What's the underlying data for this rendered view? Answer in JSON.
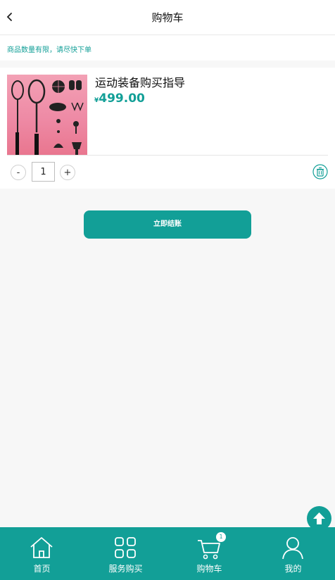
{
  "header": {
    "title": "购物车",
    "back_icon": "chevron-left-icon"
  },
  "notice": {
    "text": "商品数量有限，请尽快下单"
  },
  "cart_item": {
    "name": "运动装备购买指导",
    "currency": "¥",
    "price": "499.00",
    "quantity": "1",
    "minus_label": "-",
    "plus_label": "+",
    "image": "sports-equipment-image",
    "delete_icon": "trash-icon"
  },
  "checkout": {
    "label": "立即结账"
  },
  "scroll_top": {
    "icon": "arrow-up-icon"
  },
  "tabbar": {
    "items": [
      {
        "label": "首页",
        "icon": "home-icon"
      },
      {
        "label": "服务购买",
        "icon": "grid-icon"
      },
      {
        "label": "购物车",
        "icon": "cart-icon",
        "badge": "1"
      },
      {
        "label": "我的",
        "icon": "user-icon"
      }
    ]
  },
  "colors": {
    "accent": "#129f97",
    "background": "#f7f7f7",
    "image_bg": "#ee8aa5"
  }
}
